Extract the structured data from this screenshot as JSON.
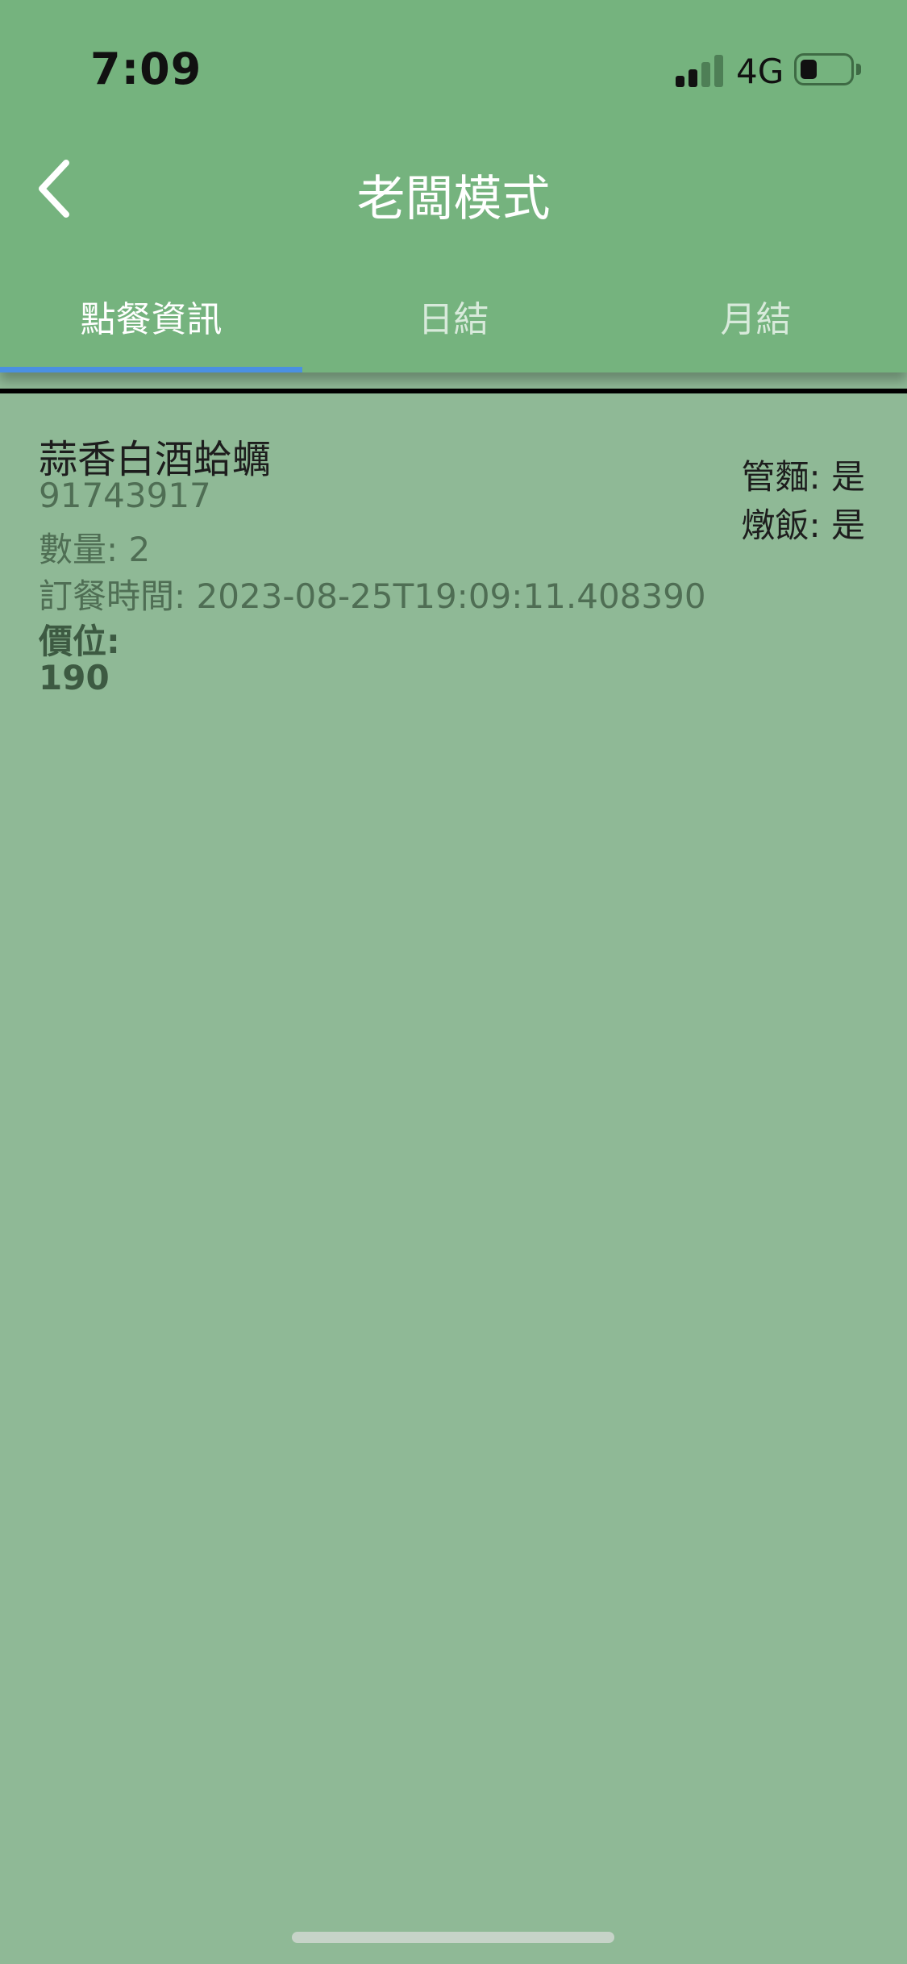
{
  "status_bar": {
    "time": "7:09",
    "network": "4G",
    "signal_bars_active": 2,
    "signal_bars_total": 4,
    "battery_level": 0.35
  },
  "nav": {
    "title": "老闆模式",
    "back_icon": "chevron-left-icon"
  },
  "tabs": [
    {
      "label": "點餐資訊",
      "active": true
    },
    {
      "label": "日結",
      "active": false
    },
    {
      "label": "月結",
      "active": false
    }
  ],
  "order": {
    "name": "蒜香白酒蛤蠣",
    "number": "91743917",
    "quantity": "數量: 2",
    "time": "訂餐時間: 2023-08-25T19:09:11.408390",
    "price_label": "價位:",
    "price_value": "190",
    "options": [
      "管麵: 是",
      "燉飯: 是"
    ]
  },
  "colors": {
    "header_bg": "#75b37e",
    "content_bg": "#8fb996",
    "tab_indicator": "#4a90e2"
  }
}
